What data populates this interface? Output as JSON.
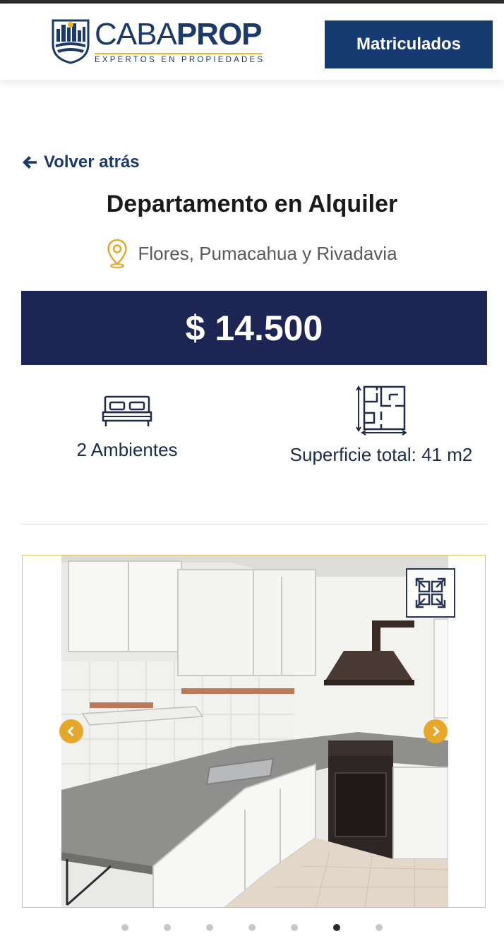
{
  "header": {
    "logo": {
      "brand_light": "CABA",
      "brand_bold": "PROP",
      "tagline": "EXPERTOS EN PROPIEDADES"
    },
    "matriculados_label": "Matriculados"
  },
  "back_link": {
    "label": "Volver atrás",
    "icon": "arrow-left-icon"
  },
  "property": {
    "title": "Departamento en Alquiler",
    "location": "Flores, Pumacahua y Rivadavia",
    "location_icon": "map-pin-icon",
    "price": "$ 14.500"
  },
  "features": [
    {
      "icon": "bed-icon",
      "label": "2 Ambientes"
    },
    {
      "icon": "floor-plan-icon",
      "label": "Superficie total: 41 m2"
    }
  ],
  "gallery": {
    "photo_description_icon": "kitchen-photo",
    "prev_icon": "chevron-left-icon",
    "next_icon": "chevron-right-icon",
    "expand_icon": "expand-icon",
    "dots_total": 7,
    "active_index": 5
  },
  "colors": {
    "navy": "#1d2554",
    "brand_blue": "#183a73",
    "accent_gold": "#e6a72a"
  }
}
